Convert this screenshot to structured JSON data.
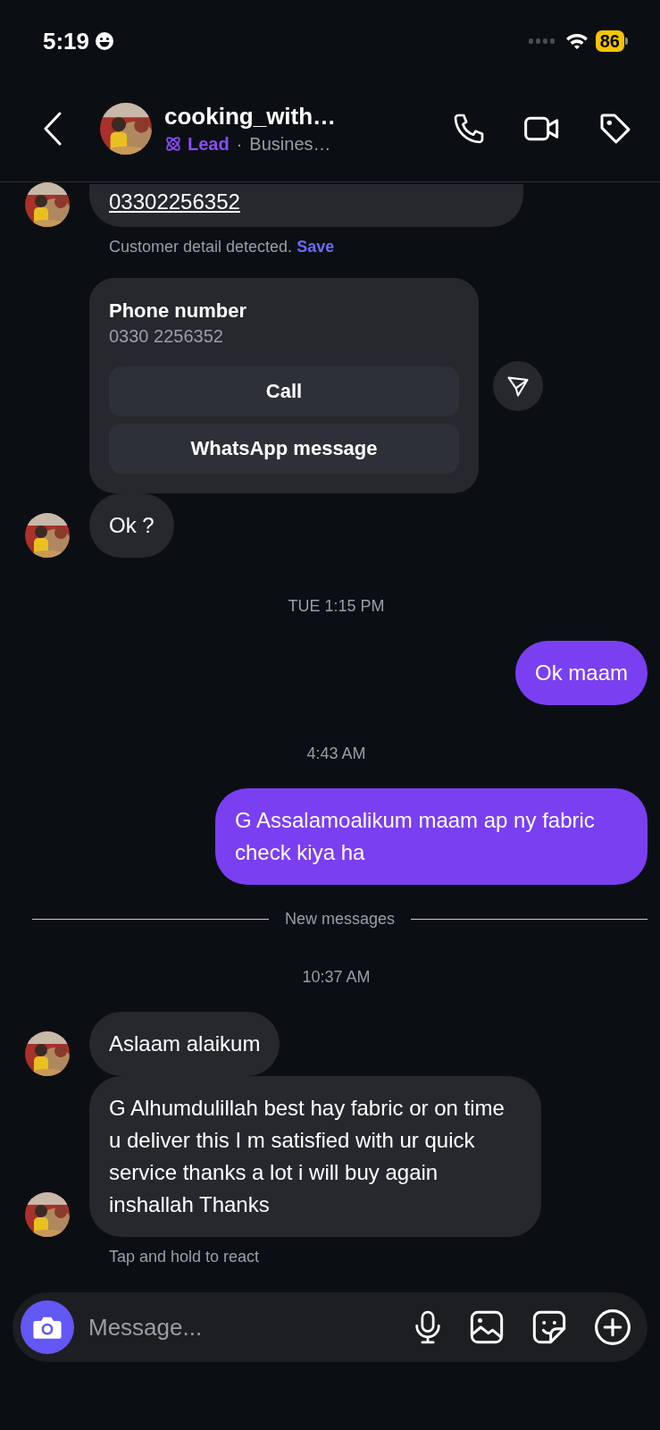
{
  "status_bar": {
    "time": "5:19",
    "battery": "86"
  },
  "header": {
    "name": "cooking_with…",
    "label": "Lead",
    "separator": "·",
    "subtitle": "Busines…"
  },
  "messages": [
    {
      "kind": "incoming",
      "text": "03302256352",
      "avatar": true,
      "link": true
    },
    {
      "kind": "note",
      "text": "Customer detail detected.",
      "action": "Save"
    },
    {
      "kind": "card",
      "title": "Phone number",
      "detail": "0330 2256352",
      "buttons": [
        "Call",
        "WhatsApp message"
      ]
    },
    {
      "kind": "incoming",
      "text": "Ok ?",
      "avatar": true,
      "link": false
    },
    {
      "kind": "time",
      "text": "TUE 1:15 PM"
    },
    {
      "kind": "outgoing",
      "text": "Ok maam"
    },
    {
      "kind": "time",
      "text": "4:43 AM"
    },
    {
      "kind": "outgoing",
      "text": "G Assalamoalikum maam ap ny fabric check kiya ha"
    },
    {
      "kind": "divider",
      "text": "New messages"
    },
    {
      "kind": "time",
      "text": "10:37 AM"
    },
    {
      "kind": "incoming",
      "text": "Aslaam alaikum",
      "avatar": true,
      "link": false
    },
    {
      "kind": "incoming",
      "text": "G Alhumdulillah best hay fabric or on time u deliver this I m satisfied with ur quick service thanks a lot i will buy again inshallah Thanks",
      "avatar": true,
      "link": false
    },
    {
      "kind": "note",
      "text": "Tap and hold to react"
    }
  ],
  "composer": {
    "placeholder": "Message..."
  }
}
